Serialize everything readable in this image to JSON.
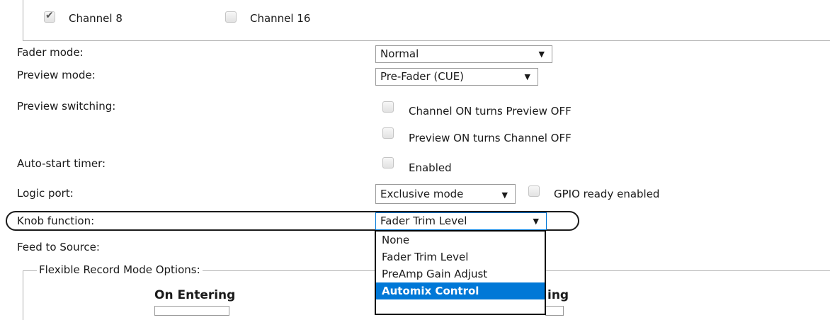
{
  "channels": {
    "channel_8": {
      "label": "Channel 8",
      "checked": true
    },
    "channel_16": {
      "label": "Channel 16",
      "checked": false
    }
  },
  "fader_mode": {
    "label": "Fader mode:",
    "value": "Normal"
  },
  "preview_mode": {
    "label": "Preview mode:",
    "value": "Pre-Fader (CUE)"
  },
  "preview_switching": {
    "label": "Preview switching:",
    "option_1": "Channel ON turns Preview OFF",
    "option_2": "Preview ON turns Channel OFF"
  },
  "auto_start_timer": {
    "label": "Auto-start timer:",
    "option": "Enabled"
  },
  "logic_port": {
    "label": "Logic port:",
    "value": "Exclusive mode",
    "gpio_label": "GPIO ready enabled"
  },
  "knob_function": {
    "label": "Knob function:",
    "value": "Fader Trim Level",
    "options": [
      "None",
      "Fader Trim Level",
      "PreAmp Gain Adjust",
      "Automix Control"
    ],
    "highlighted_option": "Automix Control"
  },
  "feed_to_source": {
    "label": "Feed to Source:"
  },
  "flexible_record": {
    "legend": "Flexible Record Mode Options:",
    "on_entering": "On Entering",
    "on_exiting_partial": "ing"
  },
  "icons": {
    "dropdown_arrow": "▼",
    "checkmark": "✔"
  }
}
